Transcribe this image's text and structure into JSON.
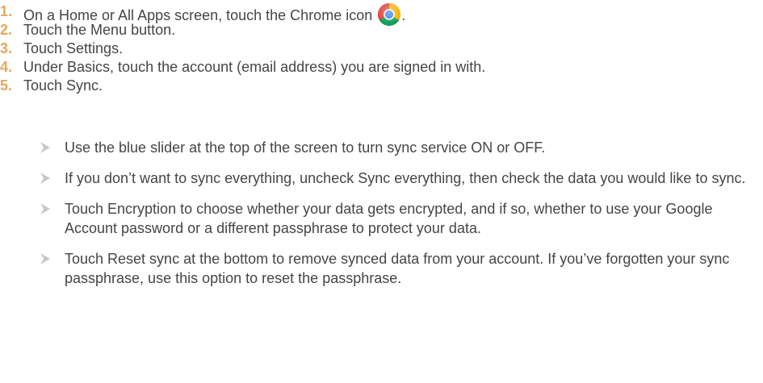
{
  "steps": [
    {
      "number": "1.",
      "text": "On a Home or All Apps screen, touch the Chrome icon",
      "suffix": "."
    },
    {
      "number": "2.",
      "text": "Touch the Menu button."
    },
    {
      "number": "3.",
      "text": "Touch Settings."
    },
    {
      "number": "4.",
      "text": "Under Basics, touch the account (email address) you are signed in with."
    },
    {
      "number": "5.",
      "text": "Touch Sync."
    }
  ],
  "bullets": [
    "Use the blue slider at the top of the screen to turn sync service ON or OFF.",
    "If you don’t want to sync everything, uncheck Sync everything, then check the data you would like to sync.",
    "Touch Encryption to choose whether your data gets encrypted, and if so, whether to use your Google Account password or a different passphrase to protect your data.",
    "Touch Reset sync at the bottom to remove synced data from your account. If you’ve forgotten your sync passphrase, use this option to reset the passphrase."
  ],
  "colors": {
    "step_number": "#e6a75c",
    "body_text": "#454545",
    "bullet_arrow": "#c8c8c8"
  },
  "icons": {
    "inline": "chrome-icon",
    "bullet": "arrow-bullet-icon"
  }
}
